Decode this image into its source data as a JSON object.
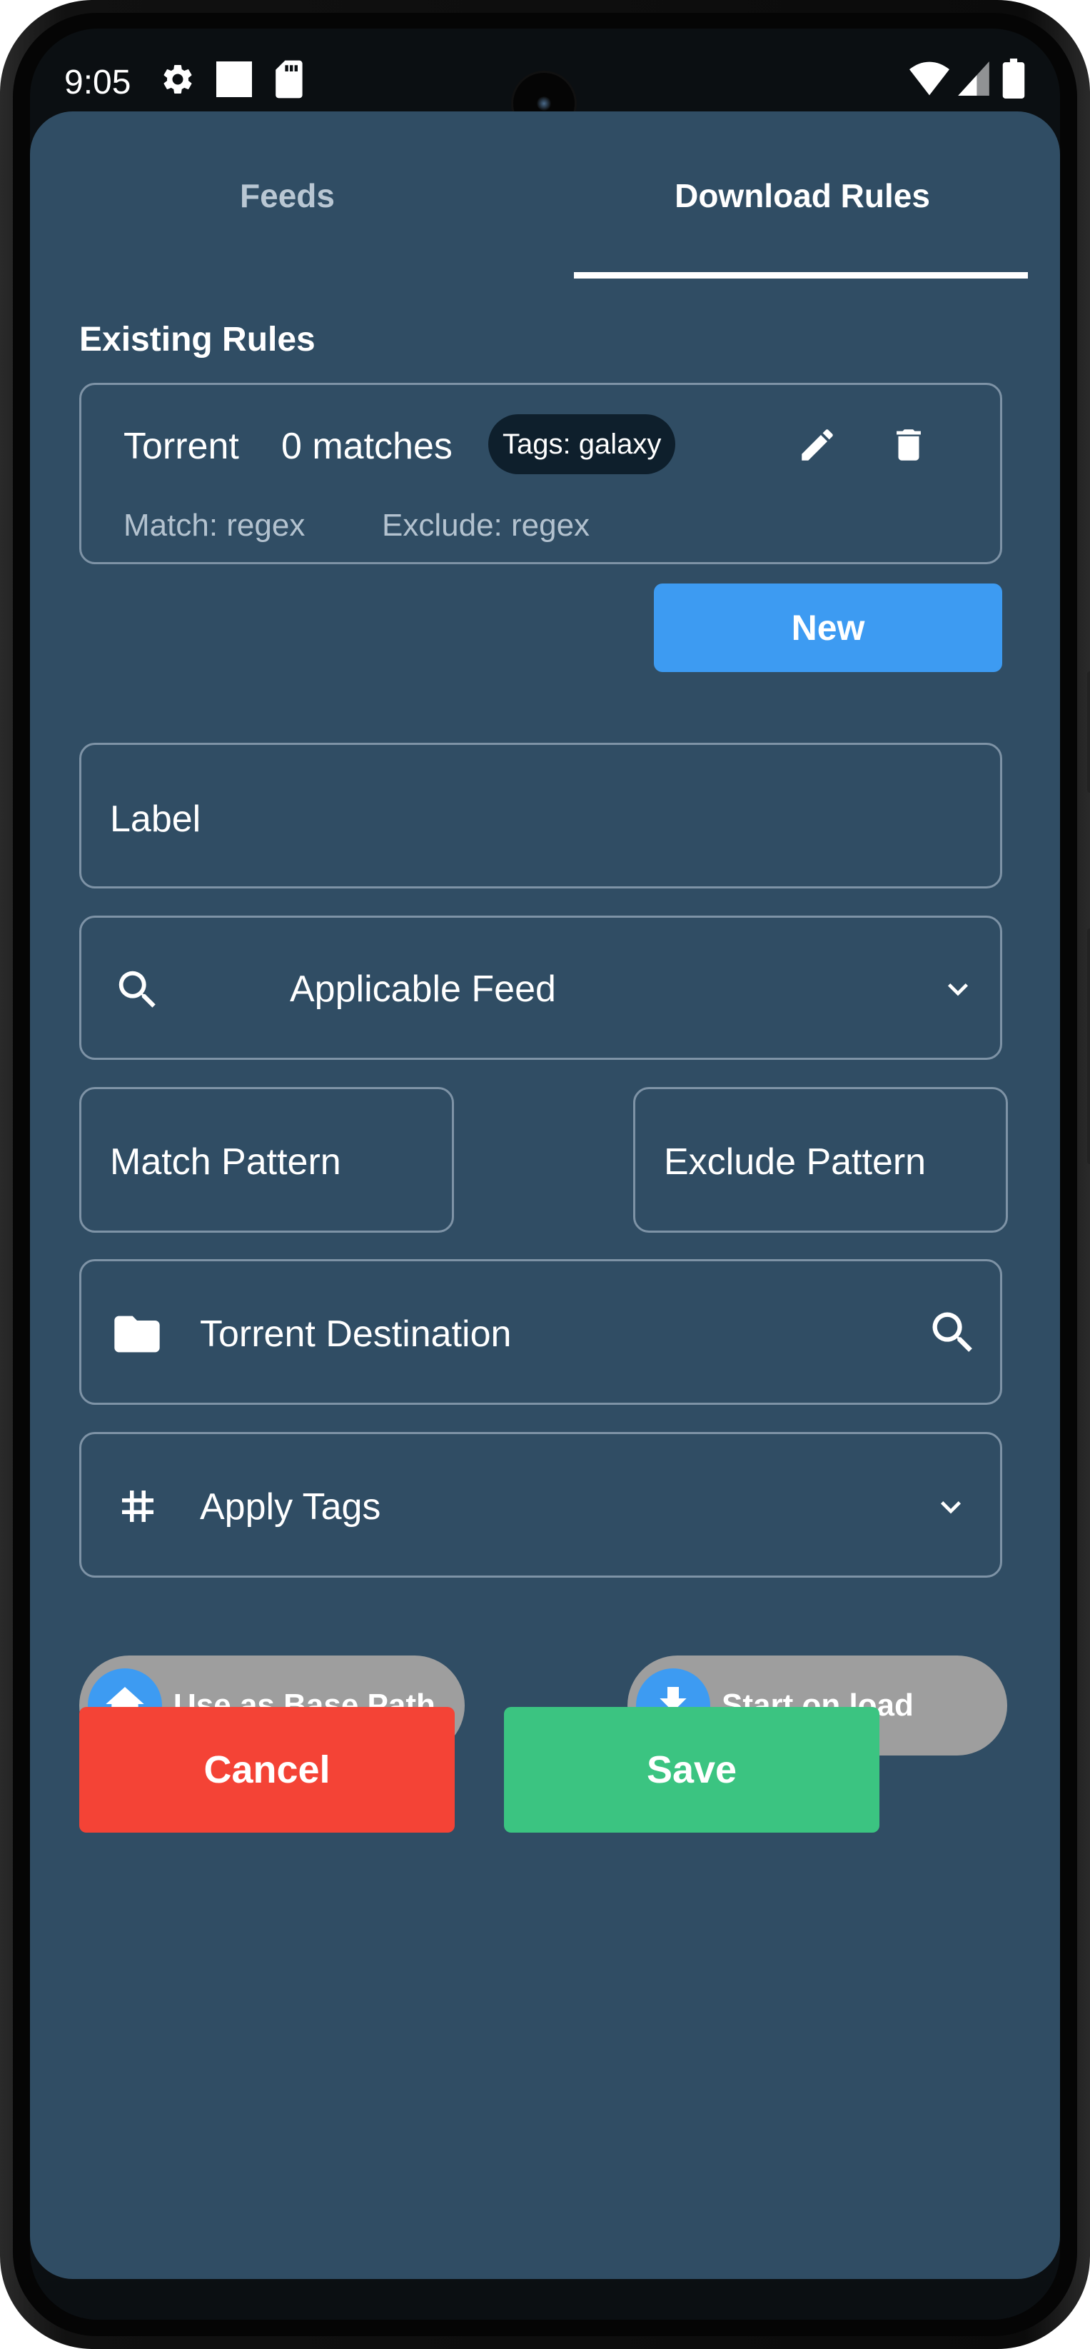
{
  "status_bar": {
    "time": "9:05",
    "left_icons": [
      "gear-icon",
      "square-icon",
      "sd-card-icon"
    ],
    "right_icons": [
      "wifi-icon",
      "signal-icon",
      "battery-icon"
    ]
  },
  "tabs": [
    {
      "label": "Feeds",
      "selected": false
    },
    {
      "label": "Download Rules",
      "selected": true
    }
  ],
  "existing_rules": {
    "title": "Existing Rules",
    "rules": [
      {
        "name": "Torrent",
        "matches": "0 matches",
        "tag": "Tags: galaxy",
        "match": "Match: regex",
        "exclude": "Exclude: regex"
      }
    ]
  },
  "new_button": "New",
  "form": {
    "label_placeholder": "Label",
    "applicable_feed": "Applicable Feed",
    "match_pattern": "Match Pattern",
    "exclude_pattern": "Exclude Pattern",
    "torrent_destination": "Torrent Destination",
    "apply_tags": "Apply Tags"
  },
  "toggles": {
    "base_path": "Use as Base Path",
    "start_on_load": "Start on load"
  },
  "actions": {
    "cancel": "Cancel",
    "save": "Save"
  },
  "colors": {
    "background": "#304d64",
    "accent": "#3d9bf2",
    "cancel": "#f44336",
    "save": "#3bc481",
    "chip": "#0e1f2c"
  }
}
